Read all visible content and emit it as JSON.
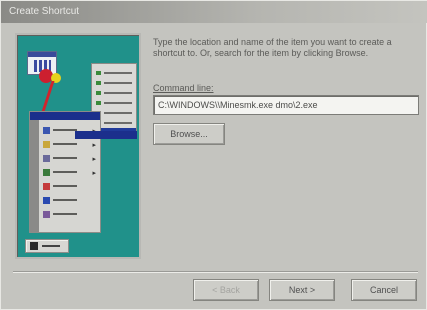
{
  "window": {
    "title": "Create Shortcut"
  },
  "instruction": "Type the location and name of the item you want to create a shortcut to. Or, search for the item by clicking Browse.",
  "command_line": {
    "label": "Command line:",
    "value": "C:\\WINDOWS\\\\Minesmk.exe  dmo\\2.exe"
  },
  "buttons": {
    "browse": "Browse...",
    "back": "< Back",
    "next": "Next >",
    "cancel": "Cancel"
  },
  "icons": {
    "illustration": "create-shortcut-illustration",
    "start": "windows-flag-icon"
  }
}
